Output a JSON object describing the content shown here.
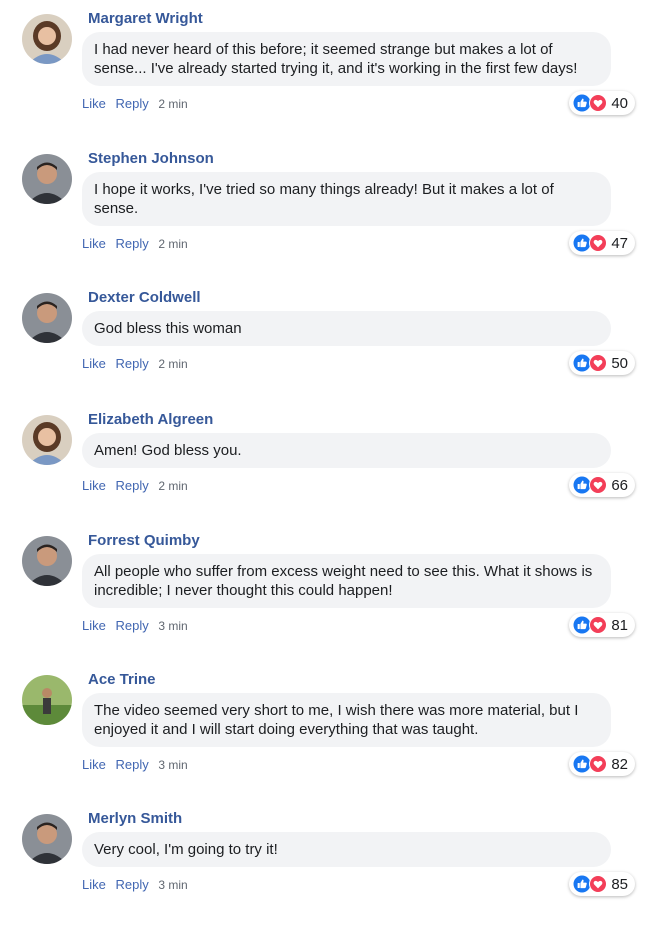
{
  "labels": {
    "like": "Like",
    "reply": "Reply"
  },
  "colors": {
    "name": "#365899",
    "link": "#4267b2",
    "bubble": "#f2f3f5",
    "like_icon": "#1877f2",
    "love_icon": "#f33e58"
  },
  "comments": [
    {
      "name": "Margaret Wright",
      "text": "I had never heard of this before; it seemed strange but makes a lot of sense... I've already started trying it, and it's working in the first few days!",
      "time": "2 min",
      "reactions": "40",
      "avatar": "avatar-woman"
    },
    {
      "name": "Stephen Johnson",
      "text": "I hope it works, I've tried so many things already! But it makes a lot of sense.",
      "time": "2 min",
      "reactions": "47",
      "avatar": "avatar-man"
    },
    {
      "name": "Dexter Coldwell",
      "text": "God bless this woman",
      "time": "2 min",
      "reactions": "50",
      "avatar": "avatar-man"
    },
    {
      "name": "Elizabeth Algreen",
      "text": "Amen! God bless you.",
      "time": "2 min",
      "reactions": "66",
      "avatar": "avatar-woman"
    },
    {
      "name": "Forrest Quimby",
      "text": "All people who suffer from excess weight need to see this. What it shows is incredible; I never thought this could happen!",
      "time": "3 min",
      "reactions": "81",
      "avatar": "avatar-man"
    },
    {
      "name": "Ace Trine",
      "text": "The video seemed very short to me, I wish there was more material, but I enjoyed it and I will start doing everything that was taught.",
      "time": "3 min",
      "reactions": "82",
      "avatar": "avatar-person-outdoors"
    },
    {
      "name": "Merlyn Smith",
      "text": "Very cool, I'm going to try it!",
      "time": "3 min",
      "reactions": "85",
      "avatar": "avatar-man"
    }
  ]
}
